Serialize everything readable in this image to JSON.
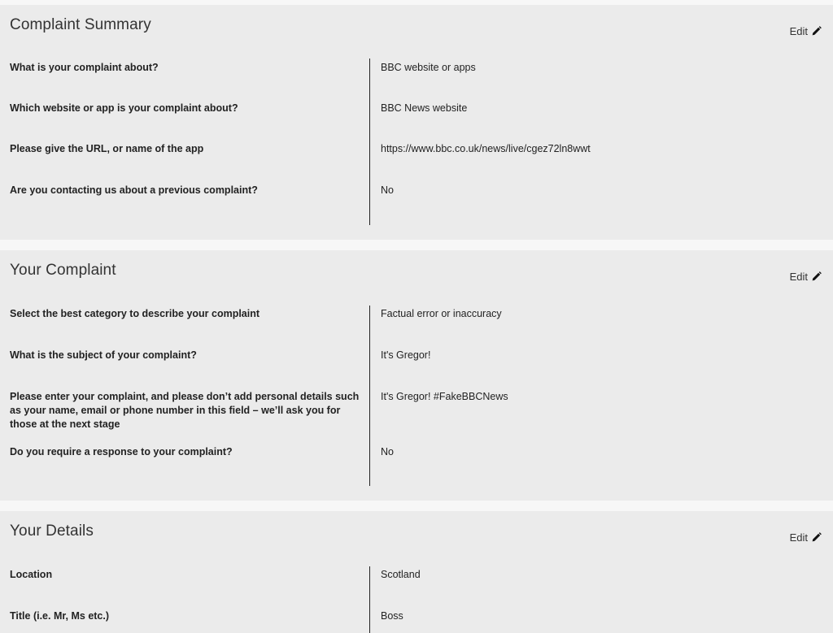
{
  "edit_label": "Edit",
  "sections": [
    {
      "title": "Complaint Summary",
      "rows": [
        {
          "q": "What is your complaint about?",
          "a": "BBC website or apps"
        },
        {
          "q": "Which website or app is your complaint about?",
          "a": "BBC News website"
        },
        {
          "q": "Please give the URL, or name of the app",
          "a": "https://www.bbc.co.uk/news/live/cgez72ln8wwt"
        },
        {
          "q": "Are you contacting us about a previous complaint?",
          "a": "No"
        }
      ]
    },
    {
      "title": "Your Complaint",
      "rows": [
        {
          "q": "Select the best category to describe your complaint",
          "a": "Factual error or inaccuracy"
        },
        {
          "q": "What is the subject of your complaint?",
          "a": "It's Gregor!"
        },
        {
          "q": "Please enter your complaint, and please don’t add personal details such as your name, email or phone number in this field – we’ll ask you for those at the next stage",
          "a": "It's Gregor! #FakeBBCNews"
        },
        {
          "q": "Do you require a response to your complaint?",
          "a": "No"
        }
      ]
    },
    {
      "title": "Your Details",
      "rows": [
        {
          "q": "Location",
          "a": "Scotland"
        },
        {
          "q": "Title (i.e. Mr, Ms etc.)",
          "a": "Boss"
        }
      ]
    }
  ],
  "icons": {
    "edit": "pencil-icon"
  }
}
